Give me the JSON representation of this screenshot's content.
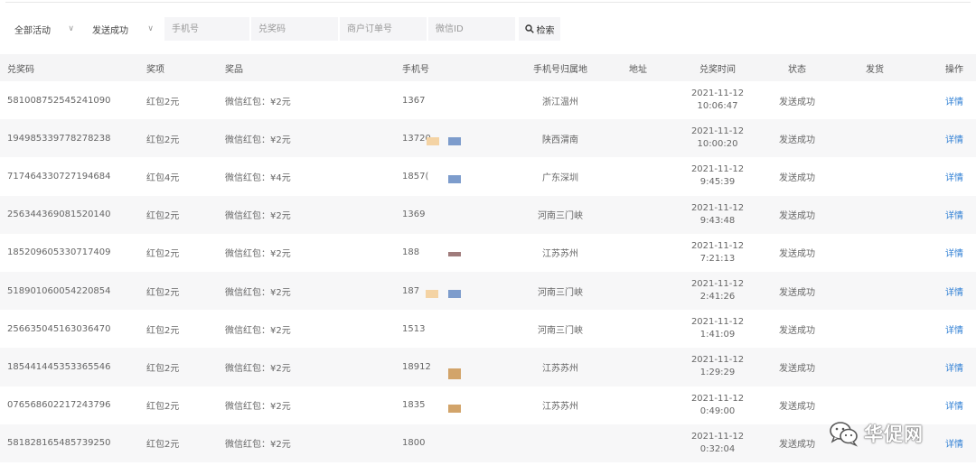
{
  "filters": {
    "activity": "全部活动",
    "status": "发送成功",
    "phone_placeholder": "手机号",
    "code_placeholder": "兑奖码",
    "order_placeholder": "商户订单号",
    "wechat_placeholder": "微信ID",
    "search_label": "检索"
  },
  "table": {
    "headers": {
      "code": "兑奖码",
      "award": "奖项",
      "prize": "奖品",
      "phone": "手机号",
      "region": "手机号归属地",
      "address": "地址",
      "time": "兑奖时间",
      "status": "状态",
      "ship": "发货",
      "op": "操作"
    },
    "rows": [
      {
        "code": "581008752545241090",
        "award": "红包2元",
        "prize": "微信红包：¥2元",
        "phone": "1367",
        "region": "浙江温州",
        "date": "2021-11-12",
        "time": "10:06:47",
        "status": "发送成功",
        "op": "详情"
      },
      {
        "code": "194985339778278238",
        "award": "红包2元",
        "prize": "微信红包：¥2元",
        "phone": "13720",
        "region": "陕西渭南",
        "date": "2021-11-12",
        "time": "10:00:20",
        "status": "发送成功",
        "op": "详情"
      },
      {
        "code": "717464330727194684",
        "award": "红包4元",
        "prize": "微信红包：¥4元",
        "phone": "1857(",
        "region": "广东深圳",
        "date": "2021-11-12",
        "time": "9:45:39",
        "status": "发送成功",
        "op": "详情"
      },
      {
        "code": "256344369081520140",
        "award": "红包2元",
        "prize": "微信红包：¥2元",
        "phone": "1369",
        "region": "河南三门峡",
        "date": "2021-11-12",
        "time": "9:43:48",
        "status": "发送成功",
        "op": "详情"
      },
      {
        "code": "185209605330717409",
        "award": "红包2元",
        "prize": "微信红包：¥2元",
        "phone": "188",
        "region": "江苏苏州",
        "date": "2021-11-12",
        "time": "7:21:13",
        "status": "发送成功",
        "op": "详情"
      },
      {
        "code": "518901060054220854",
        "award": "红包2元",
        "prize": "微信红包：¥2元",
        "phone": "187",
        "region": "河南三门峡",
        "date": "2021-11-12",
        "time": "2:41:26",
        "status": "发送成功",
        "op": "详情"
      },
      {
        "code": "256635045163036470",
        "award": "红包2元",
        "prize": "微信红包：¥2元",
        "phone": "1513",
        "region": "河南三门峡",
        "date": "2021-11-12",
        "time": "1:41:09",
        "status": "发送成功",
        "op": "详情"
      },
      {
        "code": "185441445353365546",
        "award": "红包2元",
        "prize": "微信红包：¥2元",
        "phone": "18912",
        "region": "江苏苏州",
        "date": "2021-11-12",
        "time": "1:29:29",
        "status": "发送成功",
        "op": "详情"
      },
      {
        "code": "076568602217243796",
        "award": "红包2元",
        "prize": "微信红包：¥2元",
        "phone": "1835",
        "region": "江苏苏州",
        "date": "2021-11-12",
        "time": "0:49:00",
        "status": "发送成功",
        "op": "详情"
      },
      {
        "code": "581828165485739250",
        "award": "红包2元",
        "prize": "微信红包：¥2元",
        "phone": "1800",
        "region": "",
        "date": "2021-11-12",
        "time": "0:32:04",
        "status": "发送成功",
        "op": "详情"
      }
    ]
  },
  "watermark": {
    "text": "华促网",
    "icon": "wechat-logo-icon"
  },
  "colors": {
    "link": "#2f7fd4",
    "row_alt": "#f7f7f8",
    "header_bg": "#f5f5f6"
  }
}
